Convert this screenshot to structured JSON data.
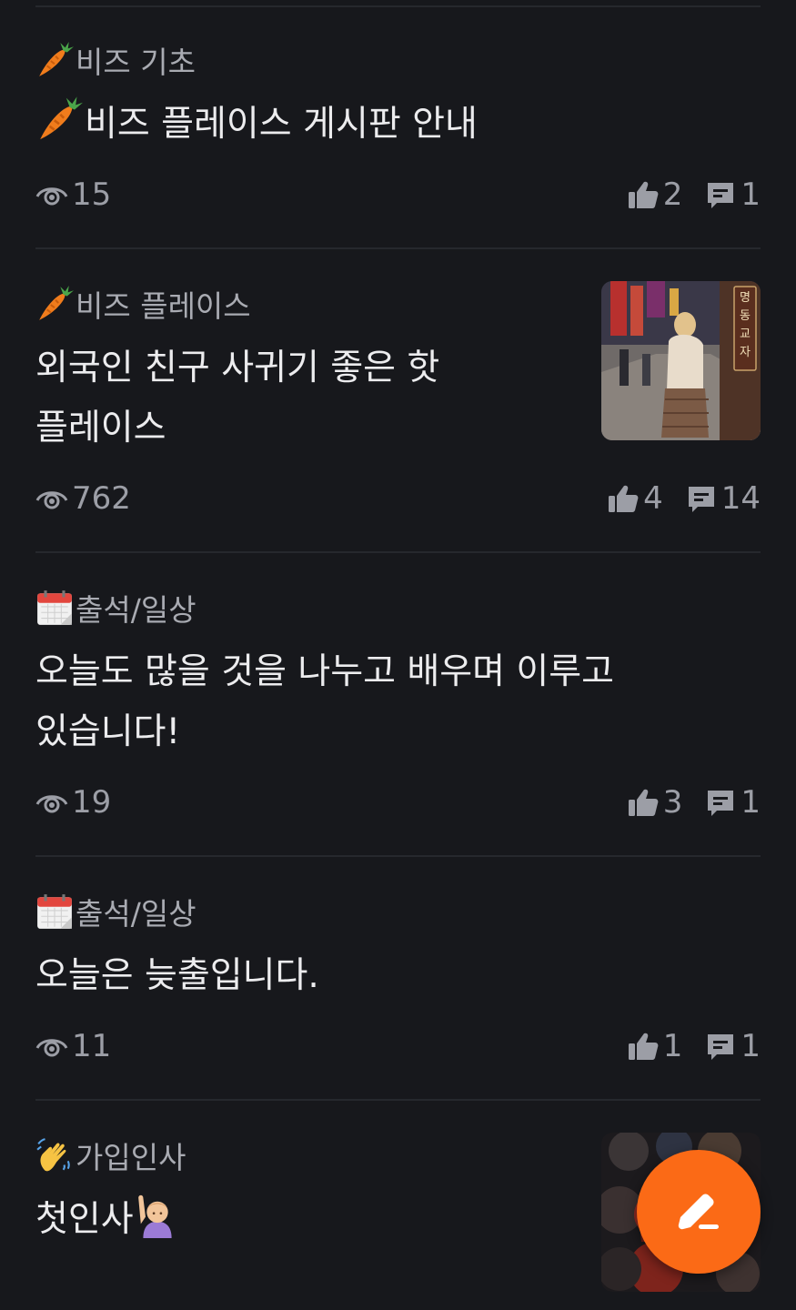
{
  "posts": [
    {
      "category": "비즈 기초",
      "category_icon": "carrot-icon",
      "title": "비즈 플레이스 게시판 안내",
      "title_icon": "carrot-icon",
      "views": "15",
      "likes": "2",
      "comments": "1"
    },
    {
      "category": "비즈 플레이스",
      "category_icon": "carrot-icon",
      "title": "외국인 친구 사귀기 좋은 핫 플레이스",
      "thumbnail": "street-photo-thumbnail",
      "thumbnail_sign": "명동교자",
      "views": "762",
      "likes": "4",
      "comments": "14"
    },
    {
      "category": "출석/일상",
      "category_icon": "calendar-icon",
      "title": "오늘도 많을 것을 나누고 배우며 이루고 있습니다!",
      "views": "19",
      "likes": "3",
      "comments": "1"
    },
    {
      "category": "출석/일상",
      "category_icon": "calendar-icon",
      "title": "오늘은 늦출입니다.",
      "views": "11",
      "likes": "1",
      "comments": "1"
    },
    {
      "category": "가입인사",
      "category_icon": "waving-hand-icon",
      "title": "첫인사",
      "title_suffix_icon": "raising-hand-icon",
      "thumbnail": "movie-poster-thumbnail"
    }
  ],
  "fab": {
    "icon": "pencil-icon",
    "color": "#fb6a16"
  },
  "colors": {
    "background": "#17181c",
    "divider": "#26282d",
    "meta_text": "#9c9ea6",
    "accent": "#fb6a16"
  }
}
